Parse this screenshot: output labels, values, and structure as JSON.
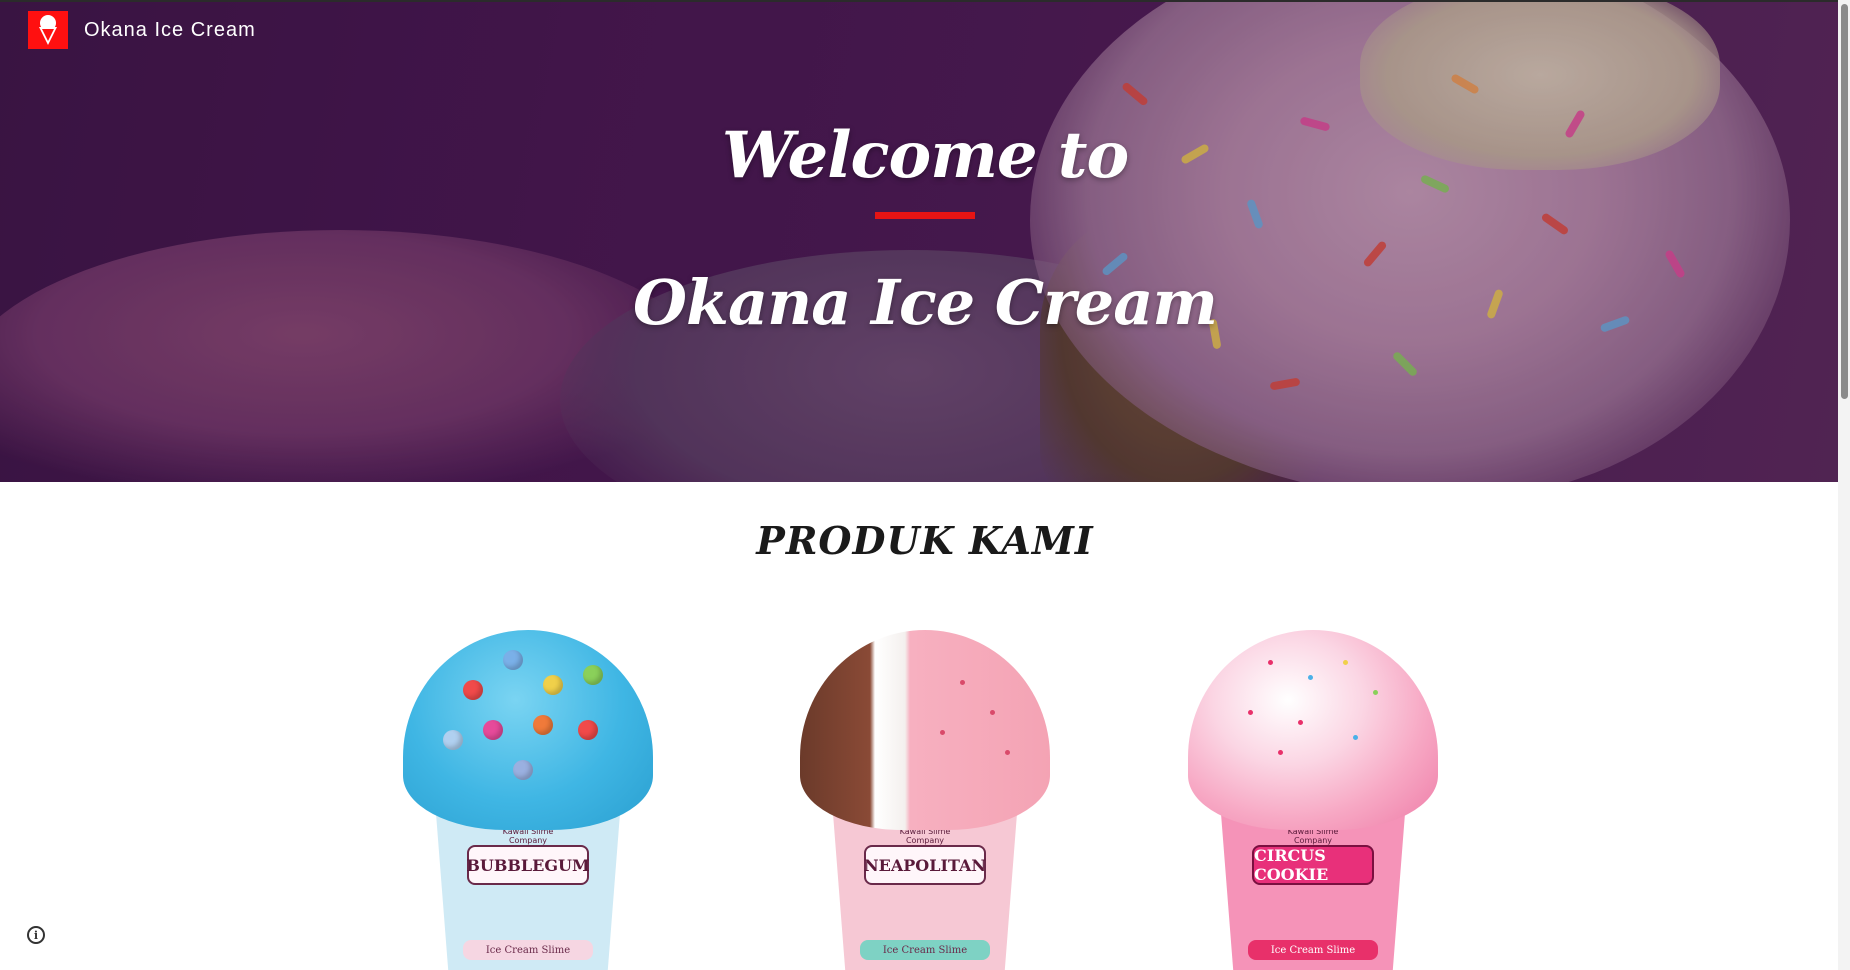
{
  "nav": {
    "brand": "Okana Ice Cream",
    "logo_icon": "ice-cream-icon"
  },
  "hero": {
    "welcome": "Welcome to",
    "title": "Okana Ice Cream",
    "accent_color": "#e61414"
  },
  "products_section": {
    "title": "PRODUK KAMI",
    "items": [
      {
        "label": "BUBBLEGUM",
        "brand": "Kawaii Slime Company",
        "footer": "Ice Cream Slime",
        "scoop_color": "#3fb6e4",
        "cup_color": "#cfeaf5"
      },
      {
        "label": "NEAPOLITAN",
        "brand": "Kawaii Slime Company",
        "footer": "Ice Cream Slime",
        "scoop_color": "#f4a3b4",
        "cup_color": "#f6c8d4"
      },
      {
        "label": "CIRCUS COOKIE",
        "brand": "Kawaii Slime Company",
        "footer": "Ice Cream Slime",
        "scoop_color": "#f7a8c4",
        "cup_color": "#f593b8"
      }
    ]
  },
  "footer": {
    "info_icon": "info-icon"
  }
}
